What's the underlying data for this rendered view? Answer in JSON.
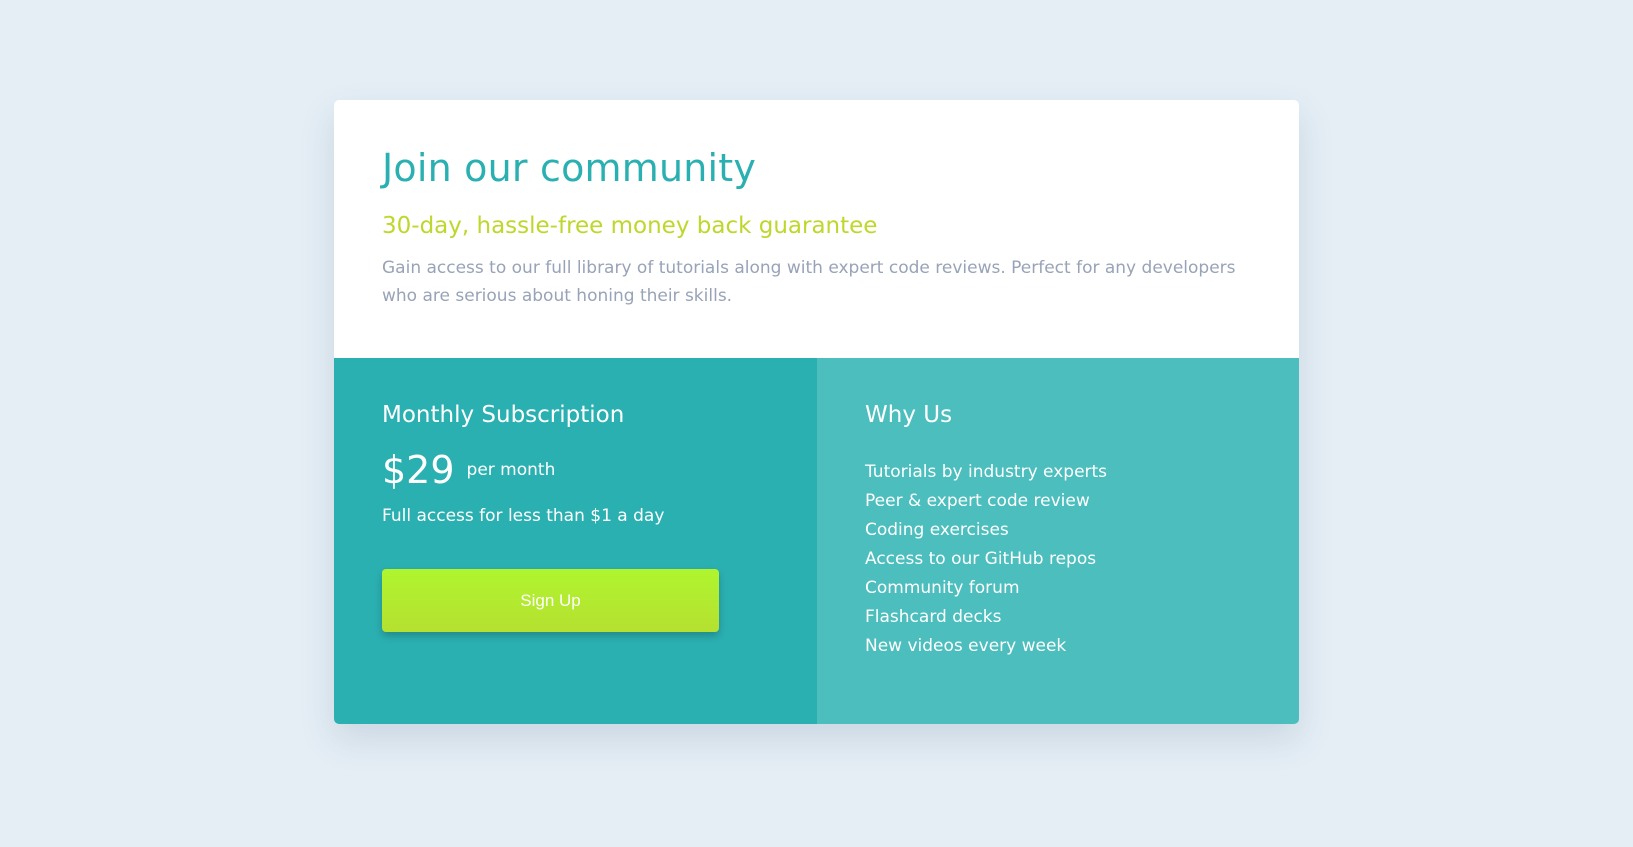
{
  "header": {
    "title": "Join our community",
    "subtitle": "30-day, hassle-free money back guarantee",
    "description": "Gain access to our full library of tutorials along with expert code reviews. Perfect for any developers who are serious about honing their skills."
  },
  "subscription": {
    "title": "Monthly Subscription",
    "price": "$29",
    "period": "per month",
    "tagline": "Full access for less than $1 a day",
    "button_label": "Sign Up"
  },
  "why_us": {
    "title": "Why Us",
    "items": [
      "Tutorials by industry experts",
      "Peer & expert code review",
      "Coding exercises",
      "Access to our GitHub repos",
      "Community forum",
      "Flashcard decks",
      "New videos every week"
    ]
  },
  "colors": {
    "background": "#e5eef5",
    "primary_teal": "#2bb0b2",
    "secondary_teal": "#4bbebd",
    "accent_lime": "#bfd72c",
    "button_green": "#b0f52f",
    "muted_text": "#98a3b7"
  }
}
